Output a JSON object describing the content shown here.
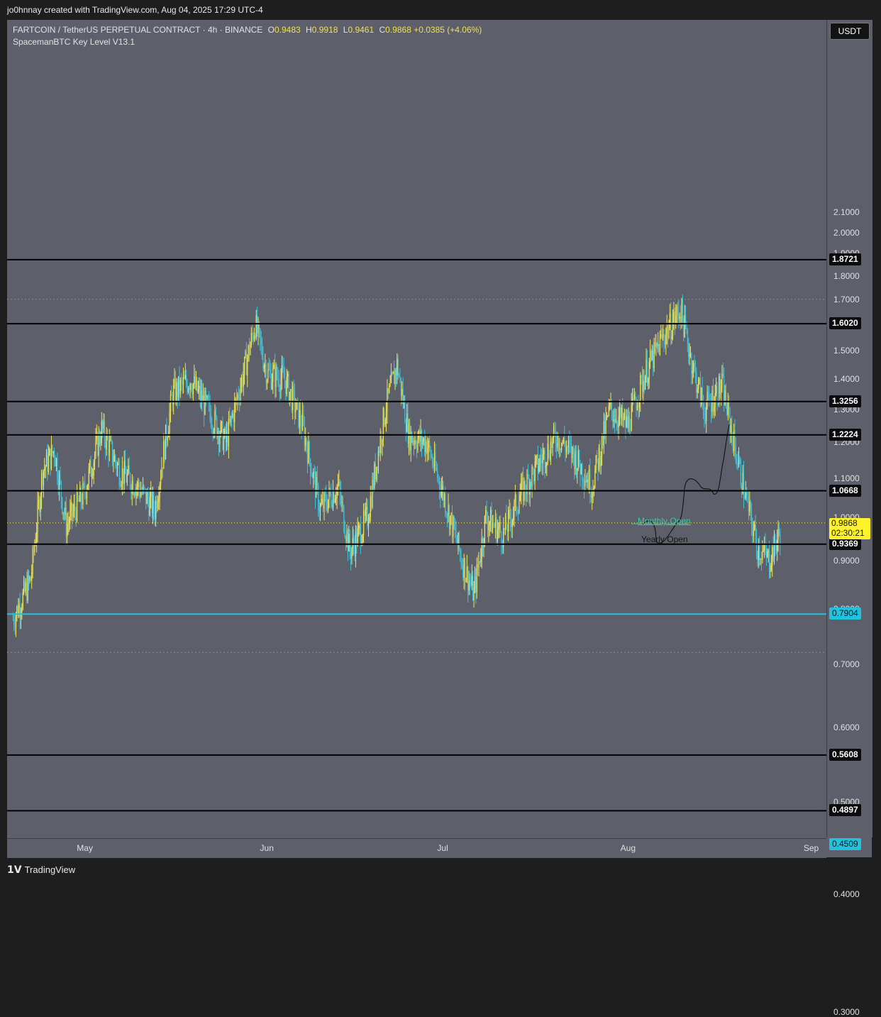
{
  "credit": "jo0hnnay created with TradingView.com, Aug 04, 2025 17:29 UTC-4",
  "legend": {
    "symbol": "FARTCOIN / TetherUS PERPETUAL CONTRACT · 4h · BINANCE",
    "o_label": "O",
    "o_value": "0.9483",
    "h_label": "H",
    "h_value": "0.9918",
    "l_label": "L",
    "l_value": "0.9461",
    "c_label": "C",
    "c_value": "0.9868",
    "change": "+0.0385 (+4.06%)",
    "indicator": "SpacemanBTC Key Level V13.1"
  },
  "currency": "USDT",
  "footer_brand": "TradingView",
  "colors": {
    "level_line": "#000000",
    "cyan_level": "#21c2de",
    "bull_candle": "#f2e45a",
    "bear_candle": "#3ec3d9",
    "background": "#5d606b"
  },
  "chart_data": {
    "type": "candlestick",
    "y_scale": "log",
    "ylim": [
      0.27,
      2.25
    ],
    "y_ticks": [
      "2.1000",
      "2.0000",
      "1.9000",
      "1.8000",
      "1.7000",
      "1.5000",
      "1.4000",
      "1.3000",
      "1.2000",
      "1.1000",
      "1.0000",
      "0.9000",
      "0.8000",
      "0.7000",
      "0.6000",
      "0.5000",
      "0.4000",
      "0.3000"
    ],
    "x_ticks": [
      "May",
      "Jun",
      "Jul",
      "Aug",
      "Sep"
    ],
    "levels": [
      {
        "value": "1.8721",
        "color": "black"
      },
      {
        "value": "1.6020",
        "color": "black"
      },
      {
        "value": "1.3256",
        "color": "black"
      },
      {
        "value": "1.2224",
        "color": "black"
      },
      {
        "value": "1.0668",
        "color": "black"
      },
      {
        "value": "0.9369",
        "color": "black",
        "label": "Yearly Open"
      },
      {
        "value": "0.7904",
        "color": "cyan"
      },
      {
        "value": "0.5608",
        "color": "black"
      },
      {
        "value": "0.4897",
        "color": "black"
      },
      {
        "value": "0.4509",
        "color": "cyan"
      }
    ],
    "current_price": "0.9868",
    "countdown": "02:30:21",
    "monthly_open_label": "Monthly Open",
    "approx_path": [
      {
        "date": "2025-04-19",
        "close": 0.78
      },
      {
        "date": "2025-04-22",
        "close": 0.86
      },
      {
        "date": "2025-04-24",
        "close": 1.12
      },
      {
        "date": "2025-04-26",
        "close": 1.18
      },
      {
        "date": "2025-04-28",
        "close": 0.98
      },
      {
        "date": "2025-05-01",
        "close": 1.06
      },
      {
        "date": "2025-05-04",
        "close": 1.24
      },
      {
        "date": "2025-05-07",
        "close": 1.12
      },
      {
        "date": "2025-05-10",
        "close": 1.08
      },
      {
        "date": "2025-05-13",
        "close": 1.02
      },
      {
        "date": "2025-05-16",
        "close": 1.35
      },
      {
        "date": "2025-05-19",
        "close": 1.4
      },
      {
        "date": "2025-05-22",
        "close": 1.3
      },
      {
        "date": "2025-05-25",
        "close": 1.2
      },
      {
        "date": "2025-05-28",
        "close": 1.42
      },
      {
        "date": "2025-05-30",
        "close": 1.6
      },
      {
        "date": "2025-06-01",
        "close": 1.42
      },
      {
        "date": "2025-06-04",
        "close": 1.4
      },
      {
        "date": "2025-06-07",
        "close": 1.25
      },
      {
        "date": "2025-06-10",
        "close": 1.02
      },
      {
        "date": "2025-06-13",
        "close": 1.08
      },
      {
        "date": "2025-06-15",
        "close": 0.92
      },
      {
        "date": "2025-06-18",
        "close": 1.0
      },
      {
        "date": "2025-06-21",
        "close": 1.3
      },
      {
        "date": "2025-06-23",
        "close": 1.45
      },
      {
        "date": "2025-06-25",
        "close": 1.22
      },
      {
        "date": "2025-06-28",
        "close": 1.2
      },
      {
        "date": "2025-07-01",
        "close": 1.05
      },
      {
        "date": "2025-07-04",
        "close": 0.9
      },
      {
        "date": "2025-07-06",
        "close": 0.83
      },
      {
        "date": "2025-07-08",
        "close": 1.0
      },
      {
        "date": "2025-07-11",
        "close": 0.96
      },
      {
        "date": "2025-07-14",
        "close": 1.06
      },
      {
        "date": "2025-07-17",
        "close": 1.14
      },
      {
        "date": "2025-07-20",
        "close": 1.22
      },
      {
        "date": "2025-07-23",
        "close": 1.16
      },
      {
        "date": "2025-07-26",
        "close": 1.08
      },
      {
        "date": "2025-07-29",
        "close": 1.3
      },
      {
        "date": "2025-08-01",
        "close": 1.25
      },
      {
        "date": "2025-08-04",
        "close": 1.42
      },
      {
        "date": "2025-08-07",
        "close": 1.55
      },
      {
        "date": "2025-08-10",
        "close": 1.66
      },
      {
        "date": "2025-08-12",
        "close": 1.45
      },
      {
        "date": "2025-08-14",
        "close": 1.3
      },
      {
        "date": "2025-08-17",
        "close": 1.38
      },
      {
        "date": "2025-08-19",
        "close": 1.2
      },
      {
        "date": "2025-08-21",
        "close": 1.05
      },
      {
        "date": "2025-08-23",
        "close": 0.93
      },
      {
        "date": "2025-08-25",
        "close": 0.9
      },
      {
        "date": "2025-08-27",
        "close": 0.97
      }
    ]
  }
}
